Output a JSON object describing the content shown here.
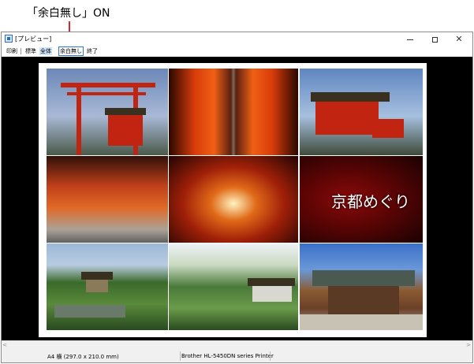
{
  "annotation": {
    "label": "「余白無し」ON",
    "highlight_color": "#d8262f"
  },
  "window": {
    "title": "[プレビュー]",
    "minimize_icon": "minimize-icon",
    "maximize_icon": "maximize-icon",
    "close_icon": "close-icon",
    "close_glyph": "✕"
  },
  "toolbar": {
    "print_label": "印刷",
    "standard_label": "標準",
    "whole_label": "全体",
    "no_margin_label": "余白無し",
    "end_label": "終了"
  },
  "preview": {
    "title_overlay": "京都めぐり",
    "photos": [
      "torii-gate-shrine",
      "torii-tunnel-path",
      "shrine-buildings",
      "torii-corridor",
      "torii-stairs",
      "title-card",
      "garden-pavilion",
      "garden-villa",
      "temple-hall"
    ]
  },
  "scrollbar": {
    "left_arrow": "<",
    "right_arrow": ">"
  },
  "status": {
    "paper": "A4 横 (297.0 x 210.0 mm)",
    "printer": "Brother HL-5450DN series Printer"
  }
}
